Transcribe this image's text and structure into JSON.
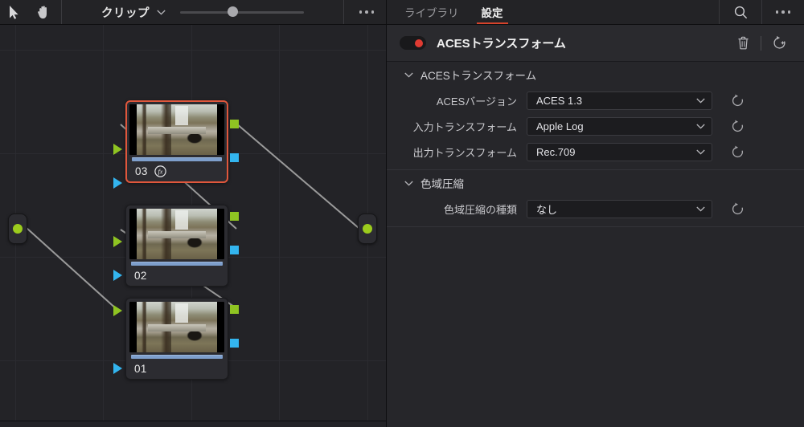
{
  "graph_toolbar": {
    "select_tool": "select-arrow",
    "pan_tool": "hand",
    "mode_label": "クリップ",
    "zoom_value": 38,
    "more_label": "..."
  },
  "nodes": [
    {
      "number": "03",
      "selected": true,
      "has_fx": true,
      "fx_label": "fx"
    },
    {
      "number": "02",
      "selected": false,
      "has_fx": false,
      "fx_label": ""
    },
    {
      "number": "01",
      "selected": false,
      "has_fx": false,
      "fx_label": ""
    }
  ],
  "connectors": {
    "source_label": "source-node",
    "output_label": "output-node"
  },
  "inspector": {
    "tabs": [
      {
        "label": "ライブラリ",
        "active": false
      },
      {
        "label": "設定",
        "active": true
      }
    ],
    "search_icon": "search-icon",
    "overflow_icon": "more-options-icon",
    "effect": {
      "enabled": true,
      "title": "ACESトランスフォーム",
      "delete_icon": "trash-icon",
      "reset_icon": "reset-version-icon"
    },
    "sections": [
      {
        "title": "ACESトランスフォーム",
        "expanded": true,
        "rows": [
          {
            "label": "ACESバージョン",
            "value": "ACES 1.3",
            "control": "select"
          },
          {
            "label": "入力トランスフォーム",
            "value": "Apple Log",
            "control": "select"
          },
          {
            "label": "出力トランスフォーム",
            "value": "Rec.709",
            "control": "select"
          }
        ]
      },
      {
        "title": "色域圧縮",
        "expanded": true,
        "rows": [
          {
            "label": "色域圧縮の種類",
            "value": "なし",
            "control": "select"
          }
        ]
      }
    ]
  },
  "colors": {
    "accent_red": "#d6432b",
    "toggle_on": "#e03b32",
    "node_selected_border": "#e0573c",
    "port_green": "#8fc422",
    "port_blue": "#33b5ef",
    "wire": "#9a9a9a",
    "panel_bg": "#26262a",
    "graph_bg": "#232327"
  }
}
